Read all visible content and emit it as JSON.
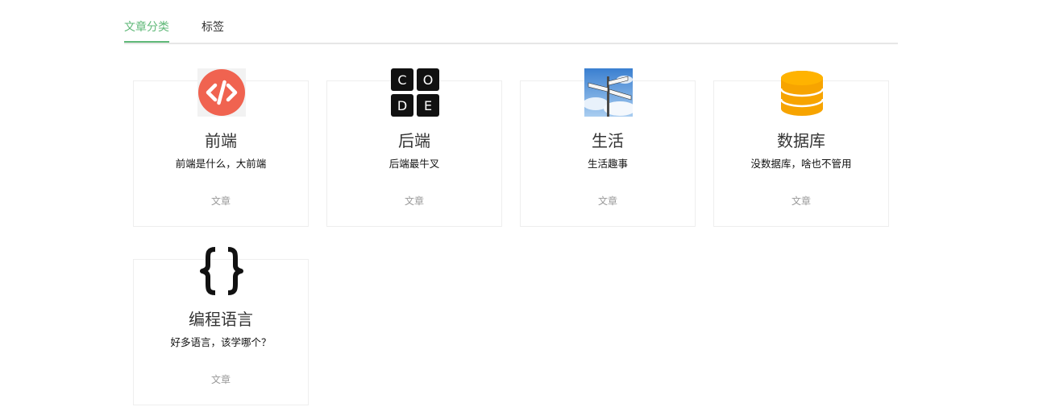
{
  "tabs": [
    {
      "label": "文章分类",
      "active": true
    },
    {
      "label": "标签",
      "active": false
    }
  ],
  "colors": {
    "accent": "#5fb878",
    "border": "#eeeeee",
    "muted": "#999999"
  },
  "categories": [
    {
      "name": "前端",
      "description": "前端是什么，大前端",
      "meta": "文章",
      "icon": "code-tag-icon"
    },
    {
      "name": "后端",
      "description": "后端最牛叉",
      "meta": "文章",
      "icon": "code-blocks-icon",
      "icon_letters": [
        "C",
        "O",
        "D",
        "E"
      ]
    },
    {
      "name": "生活",
      "description": "生活趣事",
      "meta": "文章",
      "icon": "signpost-icon"
    },
    {
      "name": "数据库",
      "description": "没数据库，啥也不管用",
      "meta": "文章",
      "icon": "database-icon"
    },
    {
      "name": "编程语言",
      "description": "好多语言，该学哪个？",
      "meta": "文章",
      "icon": "curly-braces-icon"
    }
  ]
}
